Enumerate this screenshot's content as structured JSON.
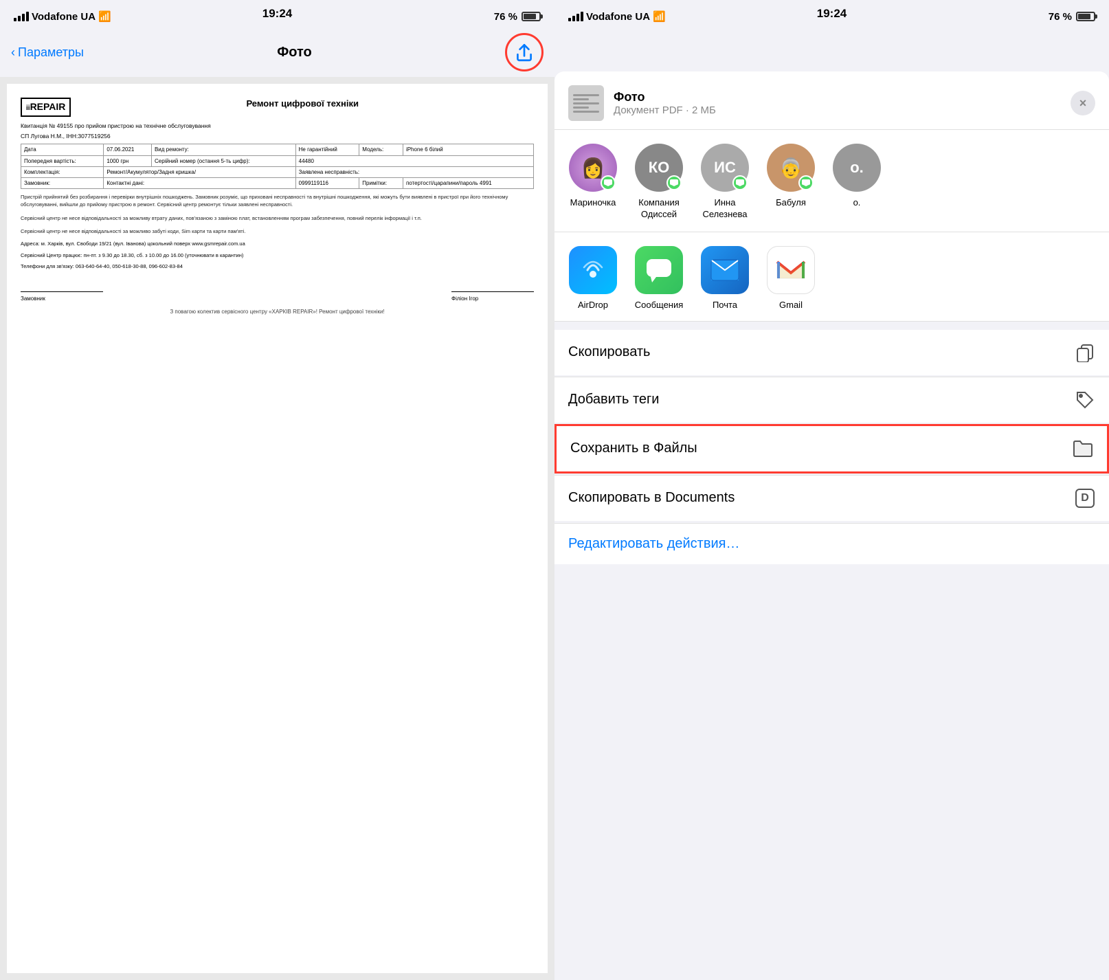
{
  "left": {
    "status": {
      "carrier": "Vodafone UA",
      "time": "19:24",
      "battery_pct": "76 %",
      "wifi": true
    },
    "nav": {
      "back_label": "Параметры",
      "title": "Фото"
    },
    "document": {
      "logo": "iiREPAIR",
      "main_title": "Ремонт цифрової техніки",
      "subtitle": "Квитанція № 49155 про прийом пристрою на технічне обслуговування",
      "row1_left": "СП Лугова Н.М., ІНН:3077519256",
      "date_label": "Дата",
      "date_value": "07.06.2021",
      "repair_type_label": "Вид ремонту:",
      "repair_type_value": "Не гарантійний",
      "model_label": "Модель:",
      "model_value": "iPhone 6 білий",
      "prev_cost_label": "Попередня вартість:",
      "prev_cost_value": "1000 грн",
      "serial_label": "Серійний номер (остання 5-ть цифр):",
      "serial_value": "44480",
      "complect_label": "Комплектація:",
      "declared_fault_label": "Заявлена несправність:",
      "owner_label": "Замовник:",
      "repair_label": "Ремонт/Акумулятор/Задня кришка/",
      "contacts_label": "Контактні дані:",
      "contacts_value": "0999119116",
      "notes_label": "Примітки:",
      "notes_value": "потертості/царапини/пароль 4991",
      "body_text": "Пристрій прийнятий без розбирання і перевірки внутрішніх пошкоджень. Замовник розуміє, що приховані несправності та внутрішні пошкодження, які можуть бути виявлені в пристрої при його технічному обслуговуванні, вийшли до прийому пристрою в ремонт. Сервісний центр ремонтує тільки заявлені несправності.",
      "body_text2": "Сервісний центр не несе відповідальності за можливу втрату даних, пов'язаною з заміною плат, встановленням програм забезпечення, повний перелік інформації і т.п.",
      "body_text3": "Сервісний центр не несе відповідальності за можливо забуті коди, Sim карти та карти пам'яті.",
      "address": "Адреса: м. Харків, вул. Свободи 19/21 (вул. Іванова) цокольний поверх www.gsmrepair.com.ua",
      "work_hours": "Сервісний Центр працює: пн-пт. з 9.30 до 18.30, сб. з 10.00 до 16.00 (уточнювати в карантин)",
      "phones": "Телефони для зв'язку: 063-640-64-40, 050-618-30-88, 096-602-83-84",
      "footer_note": "З повагою колектив сервісного центру «ХАРКІВ REPAIR»! Ремонт цифрової техніки!"
    }
  },
  "right": {
    "status": {
      "carrier": "Vodafone UA",
      "time": "19:24",
      "battery_pct": "76 %",
      "wifi": true
    },
    "share_sheet": {
      "filename": "Фото",
      "meta": "Документ PDF · 2 МБ",
      "close_label": "×",
      "contacts": [
        {
          "name": "Мариночка",
          "initials": "",
          "color": "#c8a0d0",
          "has_photo": true
        },
        {
          "name": "Компания Одиссей",
          "initials": "КО",
          "color": "#888"
        },
        {
          "name": "Инна Селезнева",
          "initials": "ИС",
          "color": "#aaa"
        },
        {
          "name": "Бабуля",
          "initials": "",
          "color": "#c8956a",
          "has_photo": true
        },
        {
          "name": "о.",
          "initials": "о.",
          "color": "#777"
        }
      ],
      "apps": [
        {
          "name": "AirDrop",
          "type": "airdrop"
        },
        {
          "name": "Сообщения",
          "type": "messages"
        },
        {
          "name": "Почта",
          "type": "mail"
        },
        {
          "name": "Gmail",
          "type": "gmail"
        }
      ],
      "actions": [
        {
          "label": "Скопировать",
          "icon": "copy"
        },
        {
          "label": "Добавить теги",
          "icon": "tag"
        },
        {
          "label": "Сохранить в Файлы",
          "icon": "folder",
          "highlighted": true
        },
        {
          "label": "Скопировать в Documents",
          "icon": "documents"
        }
      ],
      "edit_actions": "Редактировать действия…"
    }
  }
}
